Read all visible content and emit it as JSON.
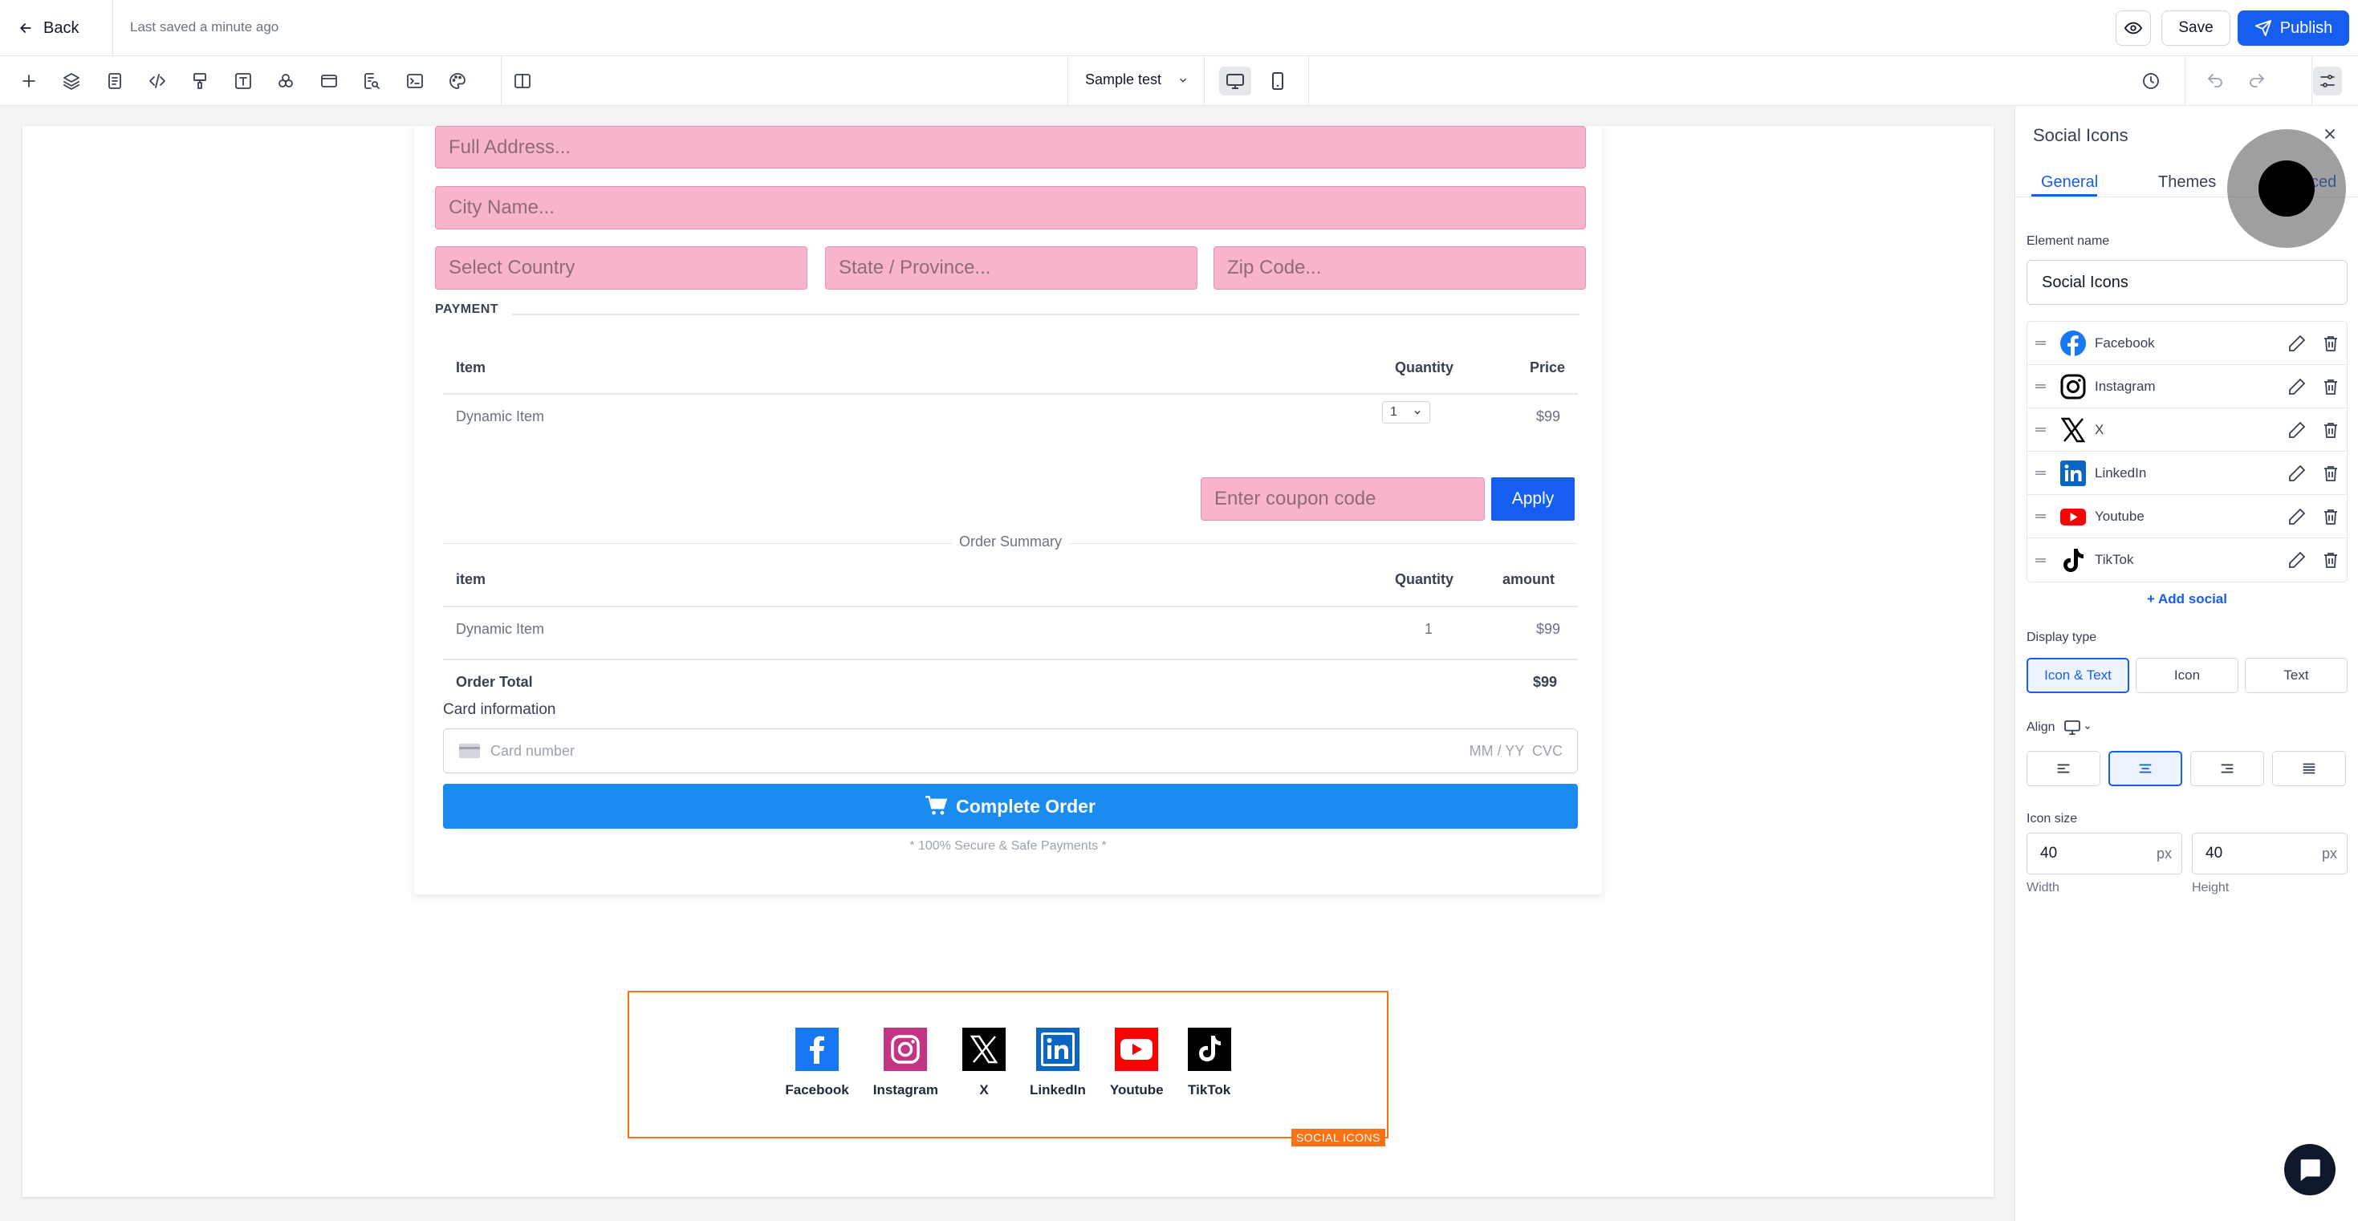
{
  "topbar": {
    "back_label": "Back",
    "saved_text": "Last saved a minute ago",
    "save_label": "Save",
    "publish_label": "Publish"
  },
  "toolbar": {
    "icons": [
      "plus-icon",
      "layers-icon",
      "page-icon",
      "code-icon",
      "paint-icon",
      "text-icon",
      "shapes-icon",
      "layout-icon",
      "search-page-icon",
      "terminal-icon",
      "palette-icon",
      "split-view-icon"
    ],
    "sample_label": "Sample test"
  },
  "form": {
    "address_placeholder": "Full Address...",
    "city_placeholder": "City Name...",
    "country_placeholder": "Select Country",
    "state_placeholder": "State / Province...",
    "zip_placeholder": "Zip Code...",
    "payment_label": "PAYMENT",
    "items_table": {
      "headers": [
        "Item",
        "Quantity",
        "Price"
      ],
      "rows": [
        {
          "item": "Dynamic Item",
          "quantity": "1",
          "price": "$99"
        }
      ]
    },
    "coupon_placeholder": "Enter coupon code",
    "apply_label": "Apply",
    "summary_label": "Order Summary",
    "summary_table": {
      "headers": [
        "item",
        "Quantity",
        "amount"
      ],
      "rows": [
        {
          "item": "Dynamic Item",
          "quantity": "1",
          "amount": "$99"
        }
      ],
      "total_label": "Order Total",
      "total_value": "$99"
    },
    "card_info_label": "Card information",
    "card_number_placeholder": "Card number",
    "card_expiry_cvc": "MM / YY  CVC",
    "complete_label": "Complete Order",
    "secure_text": "* 100% Secure & Safe Payments *"
  },
  "social_block": {
    "tag": "SOCIAL ICONS",
    "items": [
      {
        "label": "Facebook",
        "icon": "facebook-icon",
        "color": "#1877f2"
      },
      {
        "label": "Instagram",
        "icon": "instagram-icon",
        "color": "#c13584"
      },
      {
        "label": "X",
        "icon": "x-icon",
        "color": "#000000"
      },
      {
        "label": "LinkedIn",
        "icon": "linkedin-icon",
        "color": "#0a66c2"
      },
      {
        "label": "Youtube",
        "icon": "youtube-icon",
        "color": "#ff0000"
      },
      {
        "label": "TikTok",
        "icon": "tiktok-icon",
        "color": "#000000"
      }
    ]
  },
  "panel": {
    "title": "Social Icons",
    "tabs": [
      "General",
      "Themes",
      "ced"
    ],
    "element_name_label": "Element name",
    "element_name_value": "Social Icons",
    "socials": [
      "Facebook",
      "Instagram",
      "X",
      "LinkedIn",
      "Youtube",
      "TikTok"
    ],
    "add_social_label": "+ Add social",
    "display_type_label": "Display type",
    "display_options": [
      "Icon & Text",
      "Icon",
      "Text"
    ],
    "display_selected": "Icon & Text",
    "align_label": "Align",
    "icon_size_label": "Icon size",
    "width_value": "40",
    "height_value": "40",
    "unit": "px",
    "width_label": "Width",
    "height_label": "Height"
  },
  "colors": {
    "accent": "#155eef",
    "field_pink": "#f8b4cc",
    "complete_blue": "#1a8cf0",
    "selection_orange": "#f97316"
  }
}
